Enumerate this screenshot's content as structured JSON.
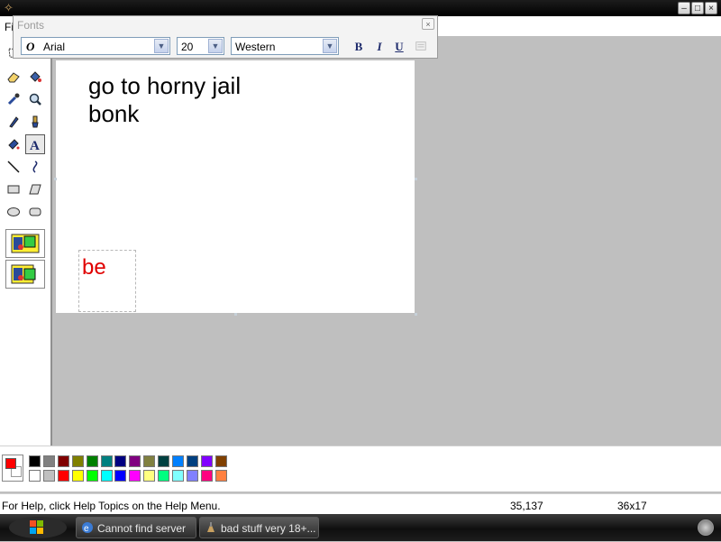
{
  "menu": {
    "file_label": "Fi"
  },
  "fonts_toolbar": {
    "title": "Fonts",
    "close_glyph": "×",
    "font_name": "Arial",
    "font_size": "20",
    "script": "Western",
    "bold_label": "B",
    "italic_label": "I",
    "underline_label": "U"
  },
  "canvas": {
    "text_line1": "go to horny jail",
    "text_line2": "bonk",
    "editing_text": "be",
    "editing_text_color": "#e00000"
  },
  "palette": {
    "foreground": "#ff0000",
    "background": "#ffffff",
    "row1": [
      "#000000",
      "#808080",
      "#800000",
      "#808000",
      "#008000",
      "#008080",
      "#000080",
      "#800080",
      "#808040",
      "#004040",
      "#0080ff",
      "#004080",
      "#8000ff",
      "#804000"
    ],
    "row2": [
      "#ffffff",
      "#c0c0c0",
      "#ff0000",
      "#ffff00",
      "#00ff00",
      "#00ffff",
      "#0000ff",
      "#ff00ff",
      "#ffff80",
      "#00ff80",
      "#80ffff",
      "#8080ff",
      "#ff0080",
      "#ff8040"
    ]
  },
  "statusbar": {
    "help_text": "For Help, click Help Topics on the Help Menu.",
    "coords": "35,137",
    "size": "36x17"
  },
  "taskbar": {
    "tasks": [
      {
        "label": "Cannot find server",
        "icon": "ie-icon"
      },
      {
        "label": "bad stuff very 18+...",
        "icon": "paint-icon"
      }
    ]
  },
  "tools": [
    "free-select-icon",
    "eraser-icon",
    "fill-bucket-icon",
    "color-picker-icon",
    "magnifier-icon",
    "pencil-icon",
    "brush-icon",
    "airbrush-icon",
    "text-tool-icon",
    "line-icon",
    "curve-icon",
    "rectangle-icon",
    "polygon-icon",
    "ellipse-icon",
    "rounded-rectangle-icon"
  ]
}
